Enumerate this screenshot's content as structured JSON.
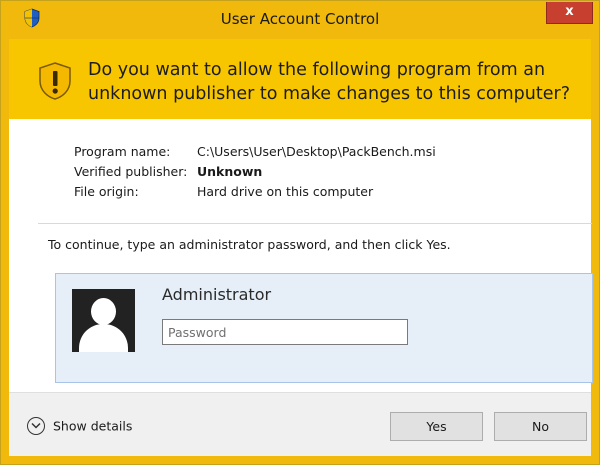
{
  "window": {
    "title": "User Account Control",
    "close_glyph": "x"
  },
  "banner": {
    "question": "Do you want to allow the following program from an unknown publisher to make changes to this computer?"
  },
  "program_info": {
    "rows": [
      {
        "label": "Program name:",
        "value": "C:\\Users\\User\\Desktop\\PackBench.msi",
        "bold": false
      },
      {
        "label": "Verified publisher:",
        "value": "Unknown",
        "bold": true
      },
      {
        "label": "File origin:",
        "value": "Hard drive on this computer",
        "bold": false
      }
    ]
  },
  "instruction": "To continue, type an administrator password, and then click Yes.",
  "credential": {
    "account_name": "Administrator",
    "password_placeholder": "Password",
    "password_value": ""
  },
  "footer": {
    "details_label": "Show details",
    "yes_label": "Yes",
    "no_label": "No"
  },
  "colors": {
    "title_bar": "#f0b90c",
    "banner": "#f7c600",
    "credential_tile": "#e6eef8",
    "close_button": "#c7402f"
  },
  "icons": {
    "title": "uac-shield-icon",
    "banner": "warning-shield-icon",
    "avatar": "user-avatar-icon",
    "details": "chevron-down-circle-icon"
  }
}
